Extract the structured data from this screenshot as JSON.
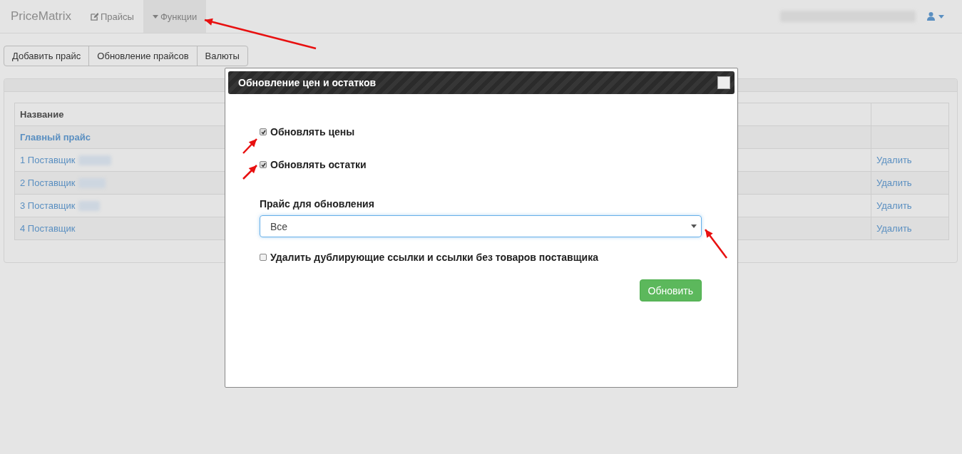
{
  "navbar": {
    "brand": "PriceMatrix",
    "items": [
      {
        "label": "Прайсы",
        "kind": "edit",
        "selected": false
      },
      {
        "label": "Функции",
        "kind": "menu",
        "selected": true
      }
    ]
  },
  "toolbar": {
    "buttons": [
      "Добавить прайс",
      "Обновление прайсов",
      "Валюты"
    ]
  },
  "table": {
    "columns": [
      "Название"
    ],
    "rows": [
      {
        "kind": "main",
        "name": "Главный прайс"
      },
      {
        "kind": "supplier",
        "name": "1 Поставщик",
        "action": "Удалить"
      },
      {
        "kind": "supplier",
        "name": "2 Поставщик",
        "action": "Удалить"
      },
      {
        "kind": "supplier",
        "name": "3 Поставщик",
        "action": "Удалить"
      },
      {
        "kind": "supplier",
        "name": "4 Поставщик",
        "action": "Удалить"
      }
    ]
  },
  "dialog": {
    "title": "Обновление цен и остатков",
    "options": [
      {
        "label": "Обновлять цены",
        "checked": true
      },
      {
        "label": "Обновлять остатки",
        "checked": true
      }
    ],
    "select": {
      "label": "Прайс для обновления",
      "value": "Все"
    },
    "extra_option": {
      "label": "Удалить дублирующие ссылки и ссылки без товаров поставщика",
      "checked": false
    },
    "submit": "Обновить"
  }
}
